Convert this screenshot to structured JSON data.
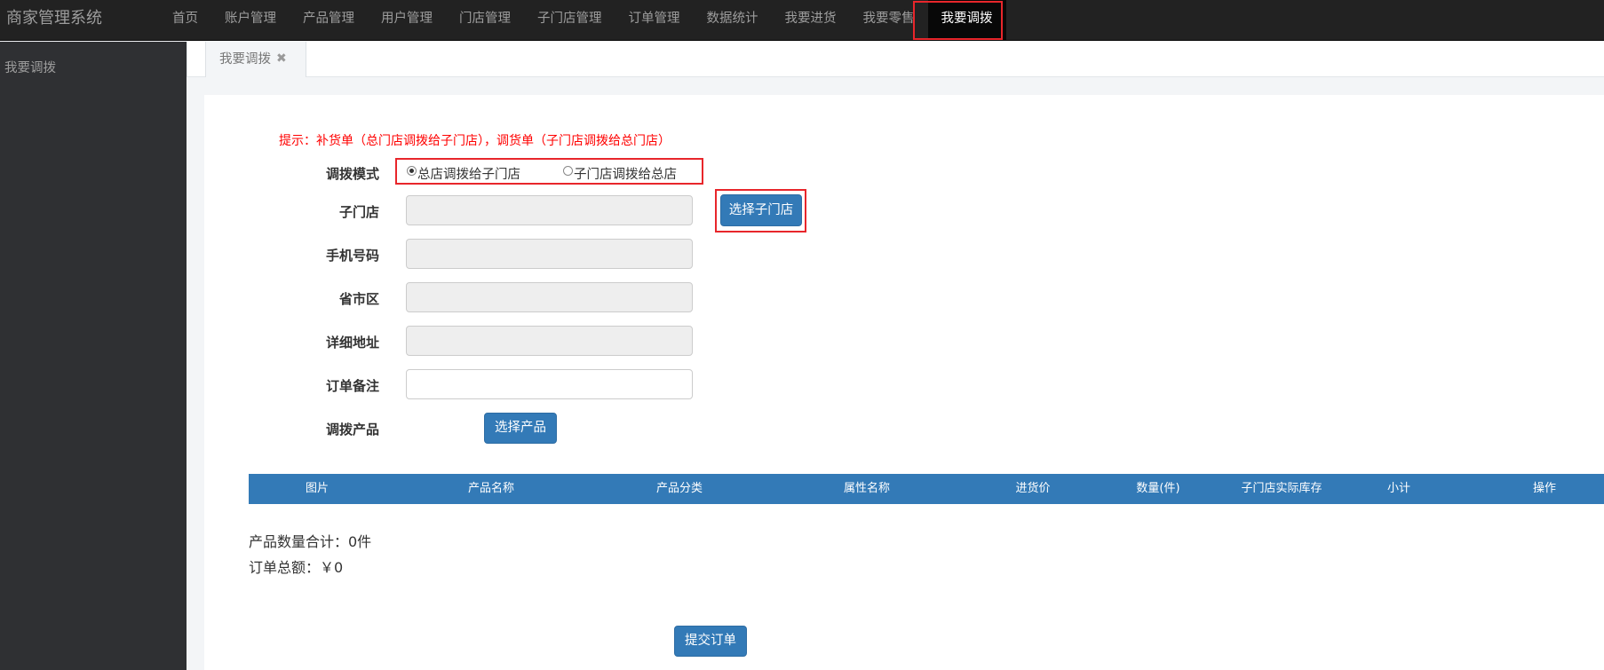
{
  "app": {
    "title": "商家管理系统"
  },
  "nav": {
    "items": [
      "首页",
      "账户管理",
      "产品管理",
      "用户管理",
      "门店管理",
      "子门店管理",
      "订单管理",
      "数据统计",
      "我要进货",
      "我要零售",
      "我要调拨"
    ],
    "active_index": 10
  },
  "sidebar": {
    "items": [
      {
        "label": "我要调拨"
      }
    ]
  },
  "tabs": [
    {
      "label": "我要调拨",
      "close_icon": "✖"
    }
  ],
  "form": {
    "tip": "提示：补货单（总门店调拨给子门店），调货单（子门店调拨给总门店）",
    "mode_label": "调拨模式",
    "mode_options": [
      "总店调拨给子门店",
      "子门店调拨给总店"
    ],
    "mode_selected": 0,
    "sub_store_label": "子门店",
    "sub_store_value": "",
    "select_store_button": "选择子门店",
    "phone_label": "手机号码",
    "phone_value": "",
    "region_label": "省市区",
    "region_value": "",
    "address_label": "详细地址",
    "address_value": "",
    "remark_label": "订单备注",
    "remark_value": "",
    "product_label": "调拨产品",
    "select_product_button": "选择产品"
  },
  "table": {
    "headers": [
      "图片",
      "产品名称",
      "产品分类",
      "属性名称",
      "进货价",
      "数量(件)",
      "子门店实际库存",
      "小计",
      "操作"
    ],
    "rows": []
  },
  "summary": {
    "quantity_text": "产品数量合计：0件",
    "amount_text": "订单总额：￥0"
  },
  "submit_button": "提交订单",
  "colors": {
    "primary": "#337ab7",
    "highlight": "#e8262b",
    "tip": "#ff0000",
    "navbar": "#222222",
    "sidebar": "#2f3033"
  }
}
